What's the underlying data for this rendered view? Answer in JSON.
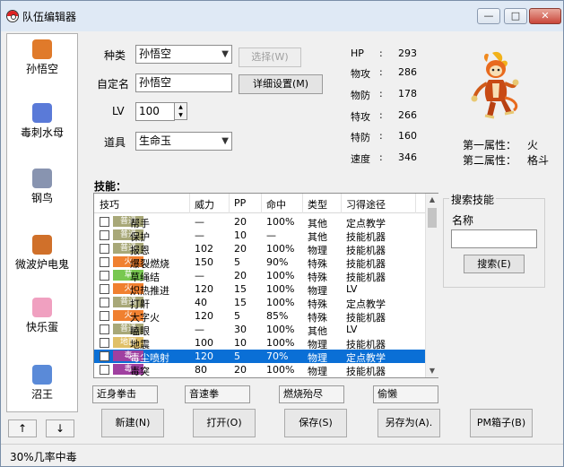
{
  "window": {
    "title": "队伍编辑器",
    "controls": {
      "minimize": "—",
      "maximize": "□",
      "close": "✕"
    }
  },
  "sidebar": {
    "items": [
      {
        "label": "孙悟空",
        "icon": "monkey-sprite-icon",
        "color": "#e07a2a"
      },
      {
        "label": "毒刺水母",
        "icon": "jellyfish-sprite-icon",
        "color": "#5a7ad8"
      },
      {
        "label": "钢鸟",
        "icon": "steel-bird-sprite-icon",
        "color": "#8894b0"
      },
      {
        "label": "微波炉电鬼",
        "icon": "microwave-ghost-sprite-icon",
        "color": "#d0702a"
      },
      {
        "label": "快乐蛋",
        "icon": "egg-sprite-icon",
        "color": "#f0a0c0"
      },
      {
        "label": "沼王",
        "icon": "swamp-king-sprite-icon",
        "color": "#5a8ad8"
      }
    ],
    "up_label": "↑",
    "down_label": "↓"
  },
  "form": {
    "species_label": "种类",
    "species_value": "孙悟空",
    "select_button": "选择(W)",
    "nickname_label": "自定名",
    "nickname_value": "孙悟空",
    "detail_button": "详细设置(M)",
    "level_label": "LV",
    "level_value": "100",
    "item_label": "道具",
    "item_value": "生命玉"
  },
  "stats": [
    {
      "name": "HP",
      "value": "293"
    },
    {
      "name": "物攻",
      "value": "286"
    },
    {
      "name": "物防",
      "value": "178"
    },
    {
      "name": "特攻",
      "value": "266"
    },
    {
      "name": "特防",
      "value": "160"
    },
    {
      "name": "速度",
      "value": "346"
    }
  ],
  "attributes": {
    "first_label": "第一属性：",
    "first_value": "火",
    "second_label": "第二属性：",
    "second_value": "格斗"
  },
  "moves": {
    "section_label": "技能：",
    "columns": [
      "技巧",
      "威力",
      "PP",
      "命中",
      "类型",
      "习得途径"
    ],
    "rows": [
      {
        "type": "普通",
        "type_color": "#a8a878",
        "name": "帮手",
        "power": "—",
        "pp": "20",
        "acc": "100%",
        "cat": "其他",
        "learn": "定点教学"
      },
      {
        "type": "普通",
        "type_color": "#a8a878",
        "name": "保护",
        "power": "—",
        "pp": "10",
        "acc": "—",
        "cat": "其他",
        "learn": "技能机器"
      },
      {
        "type": "普通",
        "type_color": "#a8a878",
        "name": "报恩",
        "power": "102",
        "pp": "20",
        "acc": "100%",
        "cat": "物理",
        "learn": "技能机器"
      },
      {
        "type": "火",
        "type_color": "#f08030",
        "name": "爆裂燃烧",
        "power": "150",
        "pp": "5",
        "acc": "90%",
        "cat": "特殊",
        "learn": "技能机器"
      },
      {
        "type": "草",
        "type_color": "#78c850",
        "name": "草绳结",
        "power": "—",
        "pp": "20",
        "acc": "100%",
        "cat": "特殊",
        "learn": "技能机器"
      },
      {
        "type": "火",
        "type_color": "#f08030",
        "name": "炽热推进",
        "power": "120",
        "pp": "15",
        "acc": "100%",
        "cat": "物理",
        "learn": "LV"
      },
      {
        "type": "普通",
        "type_color": "#a8a878",
        "name": "打鼾",
        "power": "40",
        "pp": "15",
        "acc": "100%",
        "cat": "特殊",
        "learn": "定点教学"
      },
      {
        "type": "火",
        "type_color": "#f08030",
        "name": "大字火",
        "power": "120",
        "pp": "5",
        "acc": "85%",
        "cat": "特殊",
        "learn": "技能机器"
      },
      {
        "type": "普通",
        "type_color": "#a8a878",
        "name": "瞌眼",
        "power": "—",
        "pp": "30",
        "acc": "100%",
        "cat": "其他",
        "learn": "LV"
      },
      {
        "type": "地面",
        "type_color": "#e0c068",
        "name": "地震",
        "power": "100",
        "pp": "10",
        "acc": "100%",
        "cat": "物理",
        "learn": "技能机器"
      },
      {
        "type": "毒",
        "type_color": "#a040a0",
        "name": "毒尘喷射",
        "power": "120",
        "pp": "5",
        "acc": "70%",
        "cat": "物理",
        "learn": "定点教学",
        "selected": true
      },
      {
        "type": "毒",
        "type_color": "#a040a0",
        "name": "毒突",
        "power": "80",
        "pp": "20",
        "acc": "100%",
        "cat": "物理",
        "learn": "技能机器"
      }
    ]
  },
  "search": {
    "legend": "搜索技能",
    "name_label": "名称",
    "name_value": "",
    "button": "搜索(E)"
  },
  "selected_moves": [
    "近身拳击",
    "音速拳",
    "燃烧殆尽",
    "偷懒"
  ],
  "bottom_buttons": {
    "new": "新建(N)",
    "open": "打开(O)",
    "save": "保存(S)",
    "save_as": "另存为(A).",
    "pm_box": "PM箱子(B)"
  },
  "status": {
    "text": "30%几率中毒"
  },
  "colors": {
    "selection": "#0a6fd6",
    "poke_fire": "#e06a20"
  }
}
